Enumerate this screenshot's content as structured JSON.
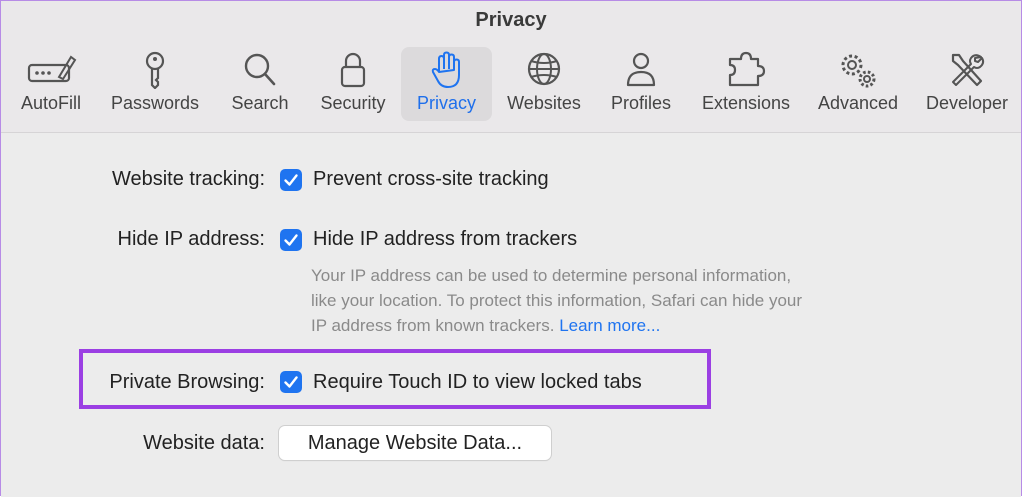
{
  "window": {
    "title": "Privacy"
  },
  "tabs": [
    {
      "label": "AutoFill",
      "icon": "autofill-icon"
    },
    {
      "label": "Passwords",
      "icon": "key-icon"
    },
    {
      "label": "Search",
      "icon": "search-icon"
    },
    {
      "label": "Security",
      "icon": "lock-icon"
    },
    {
      "label": "Privacy",
      "icon": "hand-icon",
      "active": true
    },
    {
      "label": "Websites",
      "icon": "globe-icon"
    },
    {
      "label": "Profiles",
      "icon": "person-icon"
    },
    {
      "label": "Extensions",
      "icon": "puzzle-icon"
    },
    {
      "label": "Advanced",
      "icon": "gears-icon"
    },
    {
      "label": "Developer",
      "icon": "wrench-screwdriver-icon"
    }
  ],
  "settings": {
    "website_tracking": {
      "label": "Website tracking:",
      "option": "Prevent cross-site tracking",
      "checked": true
    },
    "hide_ip": {
      "label": "Hide IP address:",
      "option": "Hide IP address from trackers",
      "checked": true,
      "help_line1": "Your IP address can be used to determine personal information,",
      "help_line2": "like your location. To protect this information, Safari can hide your",
      "help_line3": "IP address from known trackers.",
      "help_link": "Learn more..."
    },
    "private_browsing": {
      "label": "Private Browsing:",
      "option": "Require Touch ID to view locked tabs",
      "checked": true
    },
    "website_data": {
      "label": "Website data:",
      "button": "Manage Website Data..."
    }
  },
  "colors": {
    "accent": "#1f74f0",
    "highlight_border": "#9b3fe3"
  }
}
